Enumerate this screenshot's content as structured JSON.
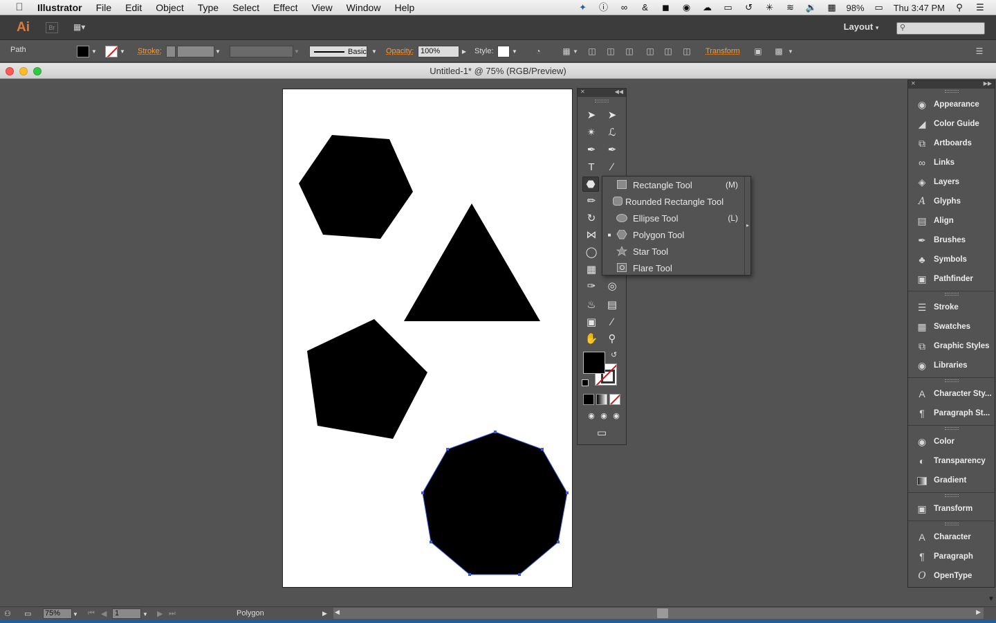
{
  "menubar": {
    "app_name": "Illustrator",
    "items": [
      "File",
      "Edit",
      "Object",
      "Type",
      "Select",
      "Effect",
      "View",
      "Window",
      "Help"
    ],
    "battery": "98%",
    "clock": "Thu 3:47 PM"
  },
  "appbar": {
    "logo": "Ai",
    "bridge": "Br",
    "workspace": "Layout"
  },
  "control": {
    "selection_type": "Path",
    "stroke_label": "Stroke:",
    "stroke_profile": "Basic",
    "opacity_label": "Opacity:",
    "opacity_value": "100%",
    "style_label": "Style:",
    "transform_label": "Transform"
  },
  "document": {
    "title": "Untitled-1* @ 75% (RGB/Preview)"
  },
  "flyout": {
    "items": [
      {
        "label": "Rectangle Tool",
        "shortcut": "(M)",
        "checked": false
      },
      {
        "label": "Rounded Rectangle Tool",
        "shortcut": "",
        "checked": false
      },
      {
        "label": "Ellipse Tool",
        "shortcut": "(L)",
        "checked": false
      },
      {
        "label": "Polygon Tool",
        "shortcut": "",
        "checked": true
      },
      {
        "label": "Star Tool",
        "shortcut": "",
        "checked": false
      },
      {
        "label": "Flare Tool",
        "shortcut": "",
        "checked": false
      }
    ]
  },
  "dock": {
    "items": [
      {
        "label": "Appearance",
        "icon": "appearance-icon"
      },
      {
        "label": "Color Guide",
        "icon": "color-guide-icon"
      },
      {
        "label": "Artboards",
        "icon": "artboards-icon"
      },
      {
        "label": "Links",
        "icon": "links-icon"
      },
      {
        "label": "Layers",
        "icon": "layers-icon"
      },
      {
        "label": "Glyphs",
        "icon": "glyphs-icon"
      },
      {
        "label": "Align",
        "icon": "align-icon"
      },
      {
        "label": "Brushes",
        "icon": "brushes-icon"
      },
      {
        "label": "Symbols",
        "icon": "symbols-icon"
      },
      {
        "label": "Pathfinder",
        "icon": "pathfinder-icon"
      },
      {
        "label": "Stroke",
        "icon": "stroke-icon"
      },
      {
        "label": "Swatches",
        "icon": "swatches-icon"
      },
      {
        "label": "Graphic Styles",
        "icon": "graphic-styles-icon"
      },
      {
        "label": "Libraries",
        "icon": "libraries-icon"
      },
      {
        "label": "Character Sty...",
        "icon": "character-styles-icon"
      },
      {
        "label": "Paragraph St...",
        "icon": "paragraph-styles-icon"
      },
      {
        "label": "Color",
        "icon": "color-icon"
      },
      {
        "label": "Transparency",
        "icon": "transparency-icon"
      },
      {
        "label": "Gradient",
        "icon": "gradient-icon"
      },
      {
        "label": "Transform",
        "icon": "transform-icon"
      },
      {
        "label": "Character",
        "icon": "character-icon"
      },
      {
        "label": "Paragraph",
        "icon": "paragraph-icon"
      },
      {
        "label": "OpenType",
        "icon": "opentype-icon"
      }
    ]
  },
  "status": {
    "zoom": "75%",
    "artboard_number": "1",
    "current_tool": "Polygon"
  },
  "colors": {
    "accent_orange": "#ff9a2e",
    "selection_blue": "#3b5bdb",
    "panel_bg": "#535353",
    "canvas_bg": "#535353"
  }
}
